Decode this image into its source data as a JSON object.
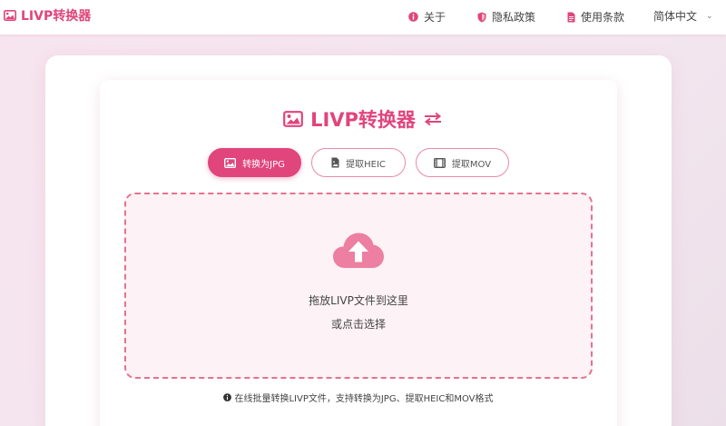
{
  "header": {
    "brand": "LIVP转换器",
    "nav": {
      "about": "关于",
      "privacy": "隐私政策",
      "terms": "使用条款"
    },
    "language": "简体中文"
  },
  "main": {
    "title": "LIVP转换器",
    "modes": [
      {
        "label": "转换为JPG",
        "active": true
      },
      {
        "label": "提取HEIC",
        "active": false
      },
      {
        "label": "提取MOV",
        "active": false
      }
    ],
    "dropzone": {
      "primary": "拖放LIVP文件到这里",
      "secondary": "或点击选择"
    },
    "hint": "在线批量转换LIVP文件，支持转换为JPG、提取HEIC和MOV格式"
  },
  "colors": {
    "accent": "#e0457b",
    "dropzone_border": "#e4738f",
    "dropzone_bg": "#fdf2f6"
  }
}
